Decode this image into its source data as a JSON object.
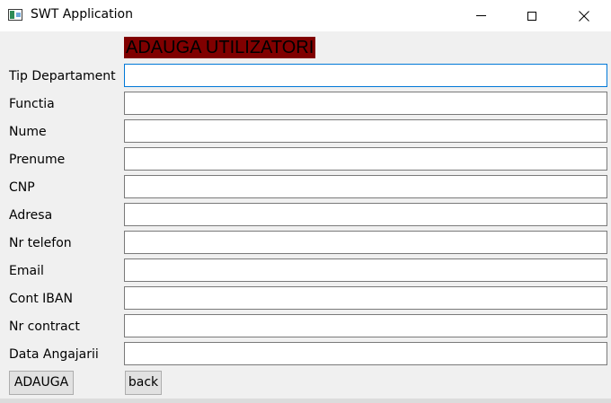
{
  "window": {
    "title": "SWT Application"
  },
  "header": {
    "title": "ADAUGA UTILIZATORI",
    "background_color": "#800000"
  },
  "form": {
    "fields": [
      {
        "label": "Tip Departament",
        "value": ""
      },
      {
        "label": "Functia",
        "value": ""
      },
      {
        "label": "Nume",
        "value": ""
      },
      {
        "label": "Prenume",
        "value": ""
      },
      {
        "label": "CNP",
        "value": ""
      },
      {
        "label": "Adresa",
        "value": ""
      },
      {
        "label": "Nr telefon",
        "value": ""
      },
      {
        "label": "Email",
        "value": ""
      },
      {
        "label": "Cont IBAN",
        "value": ""
      },
      {
        "label": "Nr contract",
        "value": ""
      },
      {
        "label": "Data Angajarii",
        "value": ""
      }
    ]
  },
  "buttons": {
    "add_label": "ADAUGA",
    "back_label": "back"
  },
  "icons": {
    "app": "app-window-icon",
    "minimize": "minimize-icon",
    "maximize": "maximize-icon",
    "close": "close-icon"
  }
}
